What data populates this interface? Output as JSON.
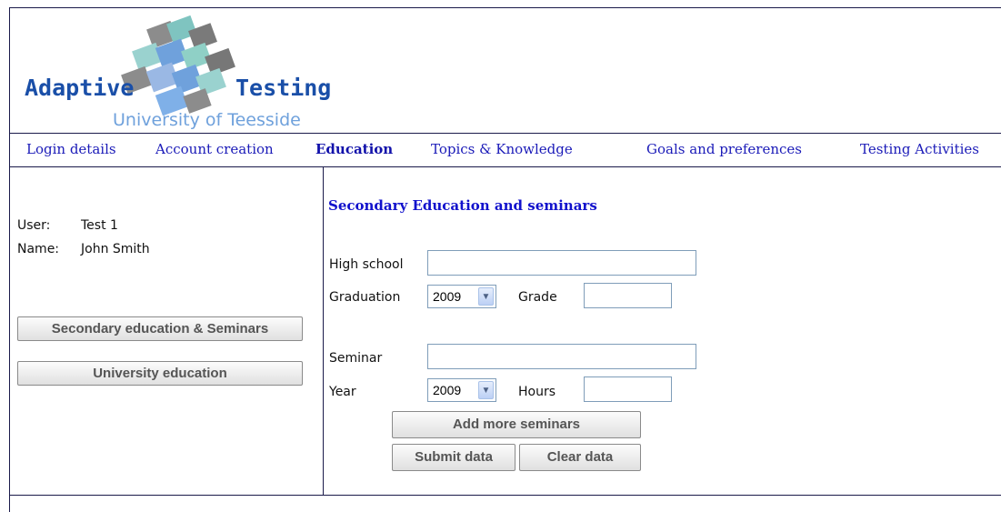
{
  "logo": {
    "word1": "Adaptive",
    "word2": "Testing",
    "subtitle": "University of Teesside"
  },
  "nav": {
    "items": [
      {
        "label": "Login details"
      },
      {
        "label": "Account creation"
      },
      {
        "label": "Education"
      },
      {
        "label": "Topics & Knowledge"
      },
      {
        "label": "Goals and preferences"
      },
      {
        "label": "Testing Activities"
      }
    ],
    "active": "Education"
  },
  "user": {
    "user_label": "User:",
    "user_value": "Test 1",
    "name_label": "Name:",
    "name_value": "John Smith"
  },
  "sidebar": {
    "secondary_button": "Secondary education & Seminars",
    "university_button": "University education"
  },
  "form": {
    "title": "Secondary Education and seminars",
    "high_school_label": "High school",
    "high_school_value": "",
    "graduation_label": "Graduation",
    "graduation_year": "2009",
    "grade_label": "Grade",
    "grade_value": "",
    "seminar_label": "Seminar",
    "seminar_value": "",
    "year_label": "Year",
    "seminar_year": "2009",
    "hours_label": "Hours",
    "hours_value": "",
    "add_button": "Add more seminars",
    "submit_button": "Submit data",
    "clear_button": "Clear data"
  },
  "colors": {
    "nav_link": "#1a1ab8",
    "title": "#1111cc",
    "logo_blue": "#1a4fa8",
    "logo_sub": "#6fa1dc"
  }
}
